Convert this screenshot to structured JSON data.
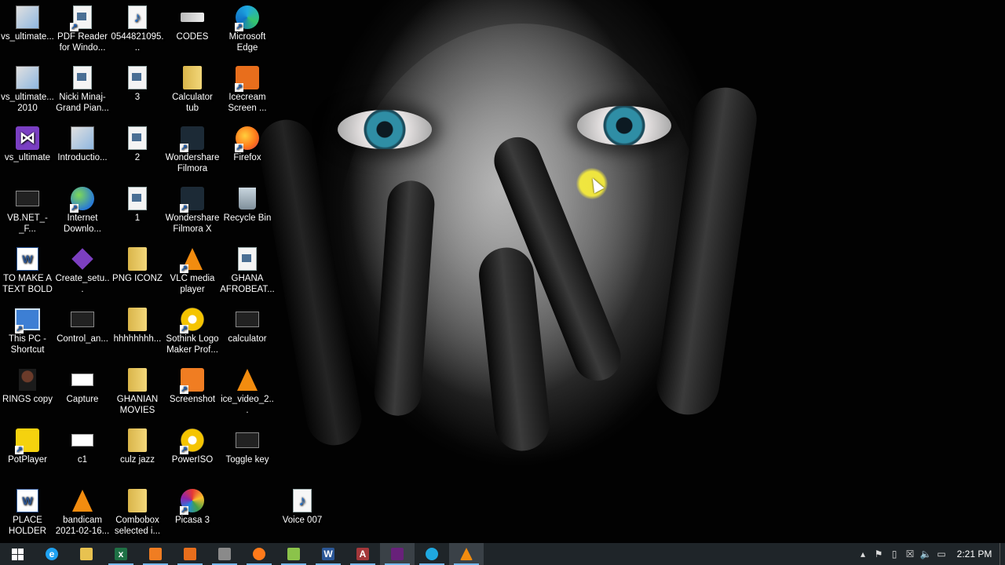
{
  "desktop": {
    "icons": [
      {
        "label": "vs_ultimate...",
        "type": "appwin",
        "shortcut": false
      },
      {
        "label": "PDF Reader for Windo...",
        "type": "pdf",
        "shortcut": true
      },
      {
        "label": "0544821095...",
        "type": "music",
        "shortcut": false
      },
      {
        "label": "CODES",
        "type": "usb",
        "shortcut": false
      },
      {
        "label": "Microsoft Edge",
        "type": "edge",
        "shortcut": true
      },
      {
        "label": "vs_ultimate... 2010",
        "type": "appwin",
        "shortcut": false
      },
      {
        "label": "Nicki Minaj- Grand Pian...",
        "type": "file",
        "shortcut": false
      },
      {
        "label": "3",
        "type": "file",
        "shortcut": false
      },
      {
        "label": "Calculator tub",
        "type": "folder",
        "shortcut": false
      },
      {
        "label": "Icecream Screen ...",
        "type": "ice",
        "shortcut": true
      },
      {
        "label": "vs_ultimate",
        "type": "purple",
        "shortcut": false
      },
      {
        "label": "Introductio...",
        "type": "appwin",
        "shortcut": false
      },
      {
        "label": "2",
        "type": "file",
        "shortcut": false
      },
      {
        "label": "Wondershare Filmora",
        "type": "wondershare",
        "shortcut": true
      },
      {
        "label": "Firefox",
        "type": "firefox",
        "shortcut": true
      },
      {
        "label": "VB.NET_-_F...",
        "type": "black",
        "shortcut": false
      },
      {
        "label": "Internet Downlo...",
        "type": "globe",
        "shortcut": true
      },
      {
        "label": "1",
        "type": "file",
        "shortcut": false
      },
      {
        "label": "Wondershare Filmora X",
        "type": "wondershare",
        "shortcut": true
      },
      {
        "label": "Recycle Bin",
        "type": "bin",
        "shortcut": false
      },
      {
        "label": "TO MAKE A TEXT BOLD",
        "type": "word",
        "shortcut": false
      },
      {
        "label": "Create_setu...",
        "type": "cube",
        "shortcut": false
      },
      {
        "label": "PNG ICONZ",
        "type": "folder",
        "shortcut": false
      },
      {
        "label": "VLC media player",
        "type": "vlc",
        "shortcut": true
      },
      {
        "label": "GHANA AFROBEAT...",
        "type": "file",
        "shortcut": false
      },
      {
        "label": "This PC - Shortcut",
        "type": "pc",
        "shortcut": true
      },
      {
        "label": "Control_an...",
        "type": "black",
        "shortcut": false
      },
      {
        "label": "hhhhhhhh...",
        "type": "folder",
        "shortcut": false
      },
      {
        "label": "Sothink Logo Maker Prof...",
        "type": "yellowdisc",
        "shortcut": true
      },
      {
        "label": "calculator",
        "type": "black",
        "shortcut": false
      },
      {
        "label": "RINGS copy",
        "type": "avatar",
        "shortcut": false
      },
      {
        "label": "Capture",
        "type": "white",
        "shortcut": false
      },
      {
        "label": "GHANIAN MOVIES",
        "type": "folder",
        "shortcut": false
      },
      {
        "label": "Screenshot",
        "type": "orange",
        "shortcut": true
      },
      {
        "label": "ice_video_2...",
        "type": "vlc",
        "shortcut": false
      },
      {
        "label": "PotPlayer",
        "type": "yellowsq",
        "shortcut": true
      },
      {
        "label": "c1",
        "type": "white",
        "shortcut": false
      },
      {
        "label": "culz jazz",
        "type": "folder",
        "shortcut": false
      },
      {
        "label": "PowerISO",
        "type": "yellowdisc",
        "shortcut": true
      },
      {
        "label": "Toggle key",
        "type": "black",
        "shortcut": false
      },
      {
        "label": "PLACE HOLDER",
        "type": "word",
        "shortcut": false
      },
      {
        "label": "bandicam 2021-02-16...",
        "type": "vlc",
        "shortcut": false
      },
      {
        "label": "Combobox selected i...",
        "type": "folder",
        "shortcut": false
      },
      {
        "label": "Picasa 3",
        "type": "picasa",
        "shortcut": true
      },
      {
        "label": "Voice 007",
        "type": "music",
        "shortcut": false
      }
    ]
  },
  "taskbar": {
    "apps": [
      {
        "name": "start",
        "color": "#1f2529"
      },
      {
        "name": "internet-explorer",
        "color": "#1ea1f1",
        "glyph": "e"
      },
      {
        "name": "file-explorer",
        "color": "#e8c250",
        "glyph": ""
      },
      {
        "name": "excel",
        "color": "#1e7145",
        "glyph": "x"
      },
      {
        "name": "icecream-screen-recorder",
        "color": "#f07d22",
        "glyph": ""
      },
      {
        "name": "screenshot",
        "color": "#e86e1c",
        "glyph": ""
      },
      {
        "name": "bandicam",
        "color": "#8a8a8a",
        "glyph": ""
      },
      {
        "name": "firefox",
        "color": "#ff7a1a",
        "glyph": ""
      },
      {
        "name": "notepad-plus",
        "color": "#8bc34a",
        "glyph": ""
      },
      {
        "name": "word",
        "color": "#2b5797",
        "glyph": "W"
      },
      {
        "name": "access",
        "color": "#a4373a",
        "glyph": "A"
      },
      {
        "name": "visual-studio",
        "color": "#68217a",
        "glyph": ""
      },
      {
        "name": "edge",
        "color": "#1fa8e0",
        "glyph": ""
      },
      {
        "name": "vlc",
        "color": "#f28c0f",
        "glyph": ""
      }
    ],
    "clock": "2:21 PM"
  }
}
